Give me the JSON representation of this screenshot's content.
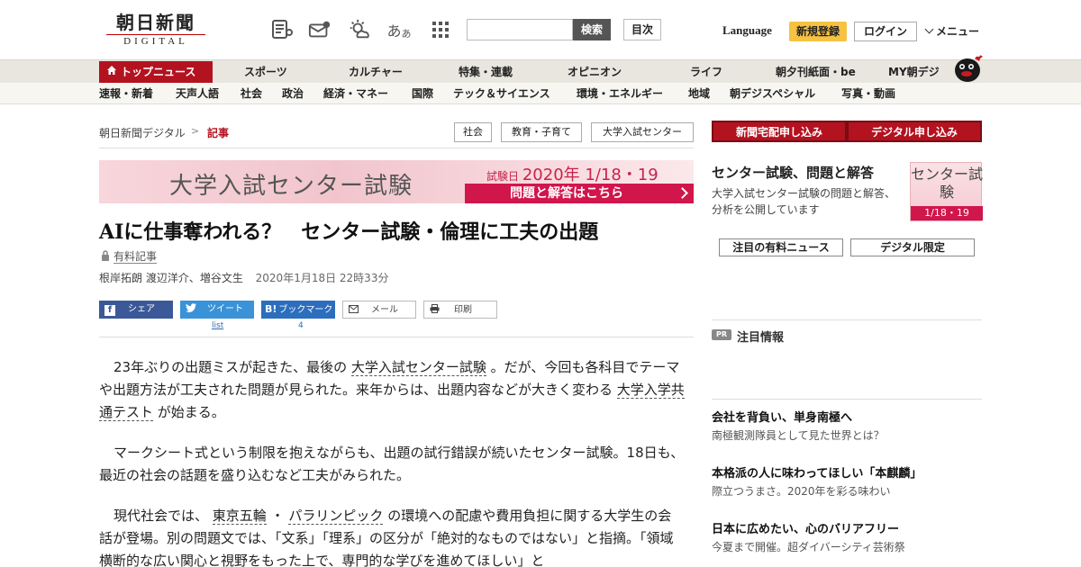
{
  "header": {
    "logo_jp": "朝日新聞",
    "logo_en": "DIGITAL",
    "search_button": "検索",
    "toc_button": "目次",
    "language": "Language",
    "register": "新規登録",
    "login": "ログイン",
    "menu": "メニュー",
    "icons": [
      "newspaper-icon",
      "mail-icon",
      "weather-icon",
      "font-size-icon",
      "grid-icon"
    ]
  },
  "nav_primary": [
    "トップニュース",
    "スポーツ",
    "カルチャー",
    "特集・連載",
    "オピニオン",
    "ライフ",
    "朝夕刊紙面・be",
    "MY朝デジ"
  ],
  "nav_secondary": [
    "速報・新着",
    "天声人語",
    "社会",
    "政治",
    "経済・マネー",
    "国際",
    "テック＆サイエンス",
    "環境・エネルギー",
    "地域",
    "朝デジスペシャル",
    "写真・動画"
  ],
  "breadcrumb": {
    "home": "朝日新聞デジタル",
    "sep": ">",
    "current": "記事"
  },
  "tags": [
    "社会",
    "教育・子育て",
    "大学入試センター"
  ],
  "banner": {
    "title": "大学入試センター試験",
    "date_label": "試験日",
    "date_value": "2020年 1/18・19",
    "link": "問題と解答はこちら"
  },
  "article": {
    "headline": "AIに仕事奪われる？　センター試験・倫理に工夫の出題",
    "paid_label": "有料記事",
    "byline": "根岸拓朗 渡辺洋介、増谷文生",
    "timestamp": "2020年1月18日 22時33分",
    "share": {
      "facebook": "シェア",
      "twitter": "ツイート",
      "twitter_sub": "list",
      "hatena": "ブックマーク",
      "hatena_sub": "4",
      "mail": "メール",
      "print": "印刷"
    },
    "p1_a": "23年ぶりの出題ミスが起きた、最後の",
    "p1_link1": "大学入試センター試験",
    "p1_b": "。だが、今回も各科目でテーマや出題方法が工夫された問題が見られた。来年からは、出題内容などが大きく変わる",
    "p1_link2": "大学入学共通テスト",
    "p1_c": "が始まる。",
    "p2": "マークシート式という制限を抱えながらも、出題の試行錯誤が続いたセンター試験。18日も、最近の社会の話題を盛り込むなど工夫がみられた。",
    "p3_a": "現代社会では、",
    "p3_link1": "東京五輪",
    "p3_b": "・",
    "p3_link2": "パラリンピック",
    "p3_c": "の環境への配慮や費用負担に関する大学生の会話が登場。別の問題文では、「文系」「理系」の区分が「絶対的なものではない」と指摘。「領域横断的な広い関心と視野をもった上で、専門的な学びを進めてほしい」と"
  },
  "sidebar": {
    "delivery_button": "新聞宅配申し込み",
    "digital_button": "デジタル申し込み",
    "promo_title": "センター試験、問題と解答",
    "promo_desc": "大学入試センター試験の問題と解答、分析を公開しています",
    "promo_thumb_text": "センター試験",
    "promo_thumb_date": "1/18・19",
    "btn_paid_news": "注目の有料ニュース",
    "btn_digital_only": "デジタル限定",
    "pr_badge": "PR",
    "pr_title": "注目情報",
    "pr_items": [
      {
        "head": "会社を背負い、単身南極へ",
        "sub": "南極観測隊員として見た世界とは？"
      },
      {
        "head": "本格派の人に味わってほしい「本麒麟」",
        "sub": "際立つうまさ。2020年を彩る味わい"
      },
      {
        "head": "日本に広めたい、心のバリアフリー",
        "sub": "今夏まで開催。超ダイバーシティ芸術祭"
      }
    ]
  },
  "colors": {
    "brand_red": "#b3121f",
    "banner_pink": "#d1164c",
    "register_yellow": "#f5c242"
  }
}
